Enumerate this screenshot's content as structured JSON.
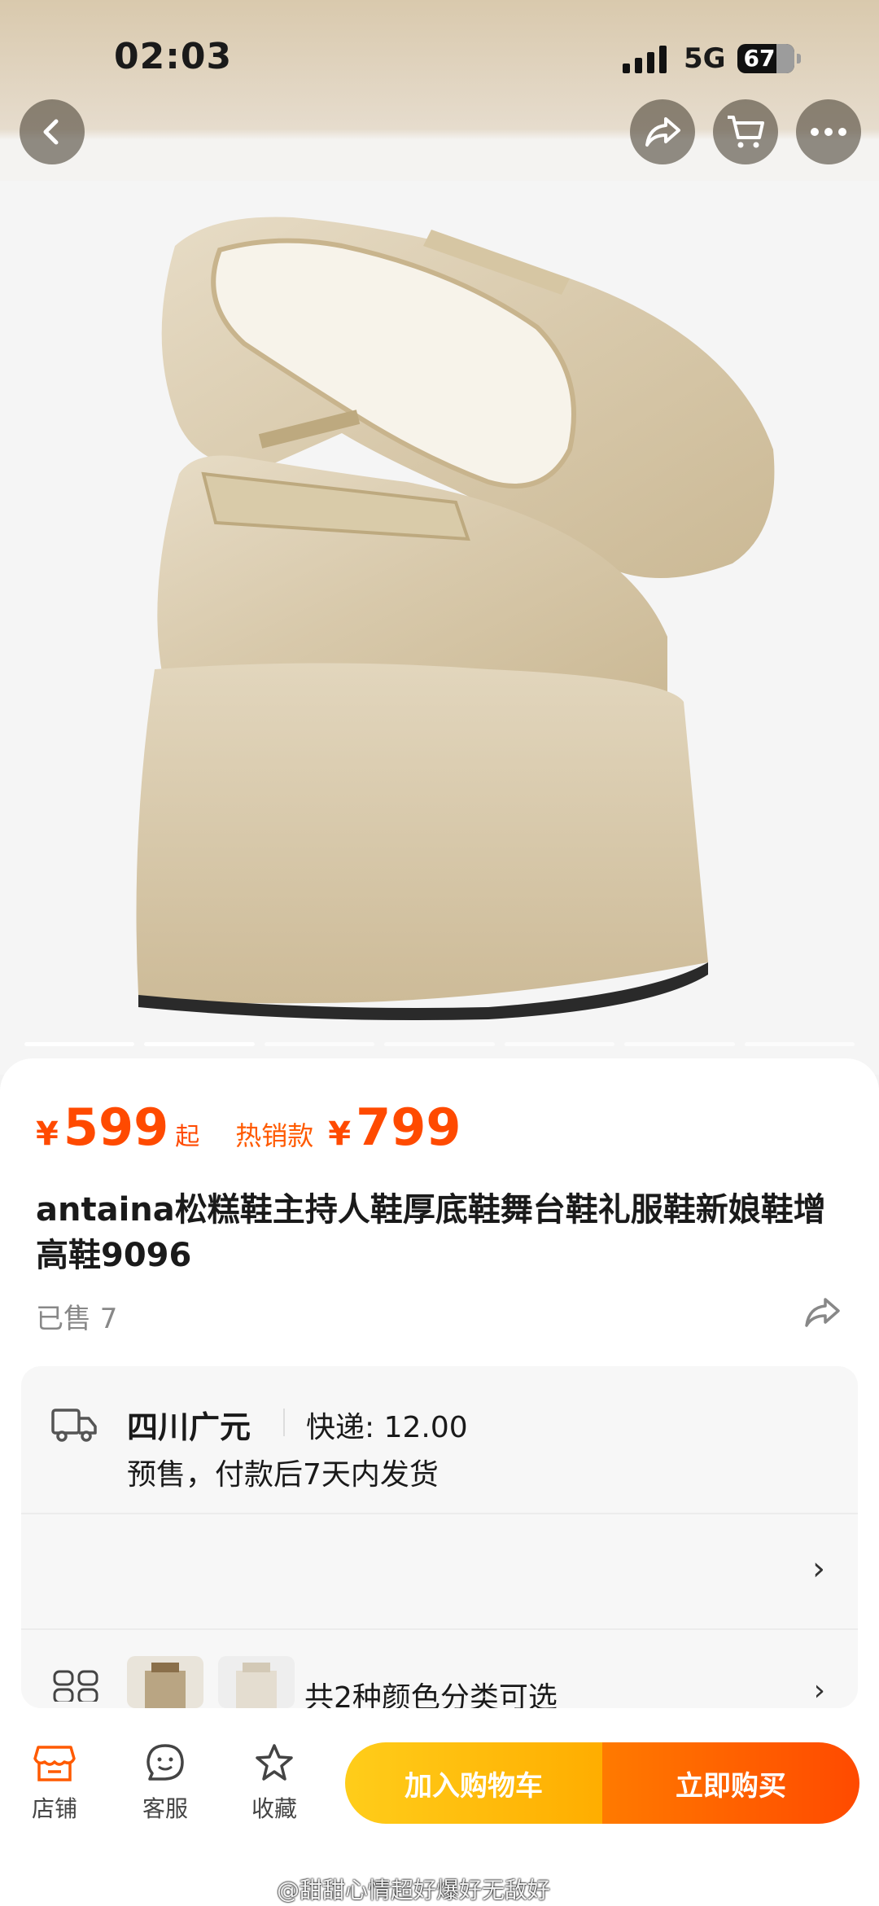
{
  "status": {
    "time": "02:03",
    "network": "5G",
    "battery": "67"
  },
  "price": {
    "currency": "¥",
    "value": "599",
    "suffix": "起",
    "hot_label": "热销款",
    "hot_currency": "¥",
    "hot_value": "799"
  },
  "product": {
    "title": "antaina松糕鞋主持人鞋厚底鞋舞台鞋礼服鞋新娘鞋增高鞋9096",
    "sold": "已售 7"
  },
  "shipping": {
    "origin": "四川广元",
    "fee": "快递: 12.00",
    "note": "预售，付款后7天内发货"
  },
  "options": {
    "colors_text": "共2种颜色分类可选"
  },
  "bottom": {
    "shop": "店铺",
    "service": "客服",
    "favorite": "收藏",
    "add_cart": "加入购物车",
    "buy_now": "立即购买"
  },
  "watermark": "@甜甜心情超好爆好无敌好",
  "colors": {
    "accent": "#ff4a00",
    "cart": "#ffad00"
  }
}
